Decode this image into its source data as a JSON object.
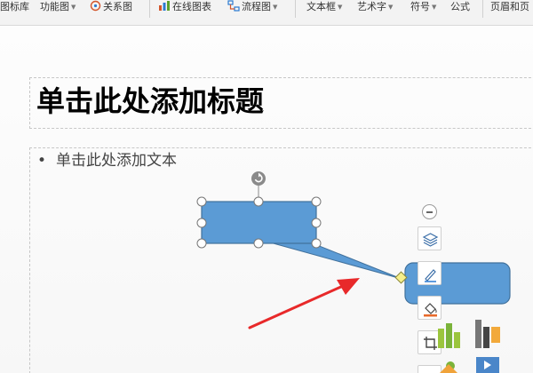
{
  "ribbon": {
    "items": [
      {
        "label": "图标库",
        "caret": false
      },
      {
        "label": "功能图",
        "caret": true
      },
      {
        "label": "关系图",
        "caret": false
      },
      {
        "label": "在线图表",
        "caret": false
      },
      {
        "label": "流程图",
        "caret": true
      },
      {
        "label": "文本框",
        "caret": true
      },
      {
        "label": "艺术字",
        "caret": true
      },
      {
        "label": "符号",
        "caret": true
      },
      {
        "label": "公式",
        "caret": false
      },
      {
        "label": "页眉和页",
        "caret": false
      }
    ]
  },
  "slide": {
    "title_placeholder": "单击此处添加标题",
    "body_bullet": "•",
    "body_placeholder": "单击此处添加文本"
  },
  "colors": {
    "shape_fill": "#5b9bd5",
    "shape_stroke": "#41719c",
    "arrow": "#e8292a",
    "connector_handle": "#f5ef8c"
  },
  "toolbar": {
    "icons": [
      "layers-icon",
      "pen-icon",
      "fill-bucket-icon",
      "crop-icon"
    ]
  }
}
